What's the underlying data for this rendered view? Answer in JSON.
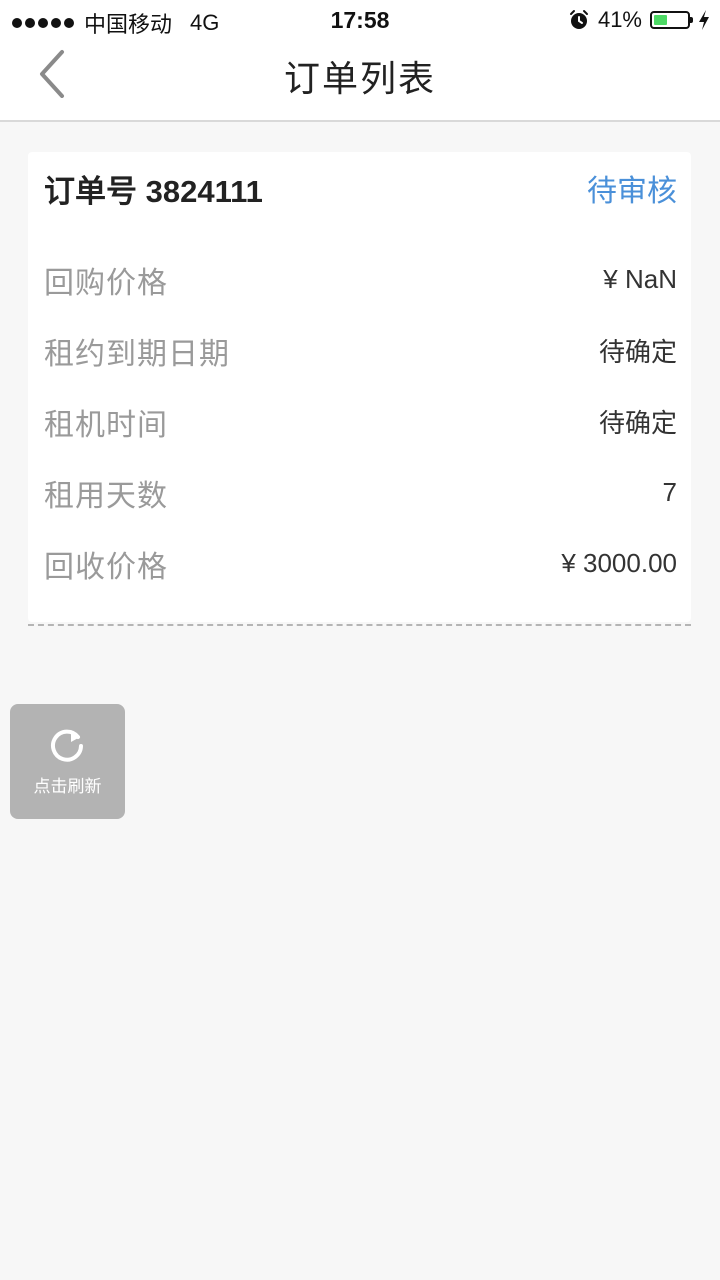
{
  "status_bar": {
    "carrier": "中国移动",
    "network": "4G",
    "time": "17:58",
    "battery_percent": "41%",
    "battery_level": 0.41,
    "battery_color": "#4cd964"
  },
  "header": {
    "title": "订单列表",
    "back_icon": "chevron-left-icon"
  },
  "order": {
    "title": "订单号 3824111",
    "status": "待审核",
    "status_color": "#4a90d9",
    "rows": [
      {
        "label": "回购价格",
        "value": "¥ NaN"
      },
      {
        "label": "租约到期日期",
        "value": "待确定"
      },
      {
        "label": "租机时间",
        "value": "待确定"
      },
      {
        "label": "租用天数",
        "value": "7"
      },
      {
        "label": "回收价格",
        "value": "¥ 3000.00"
      }
    ]
  },
  "refresh": {
    "label": "点击刷新",
    "icon": "refresh-icon"
  }
}
